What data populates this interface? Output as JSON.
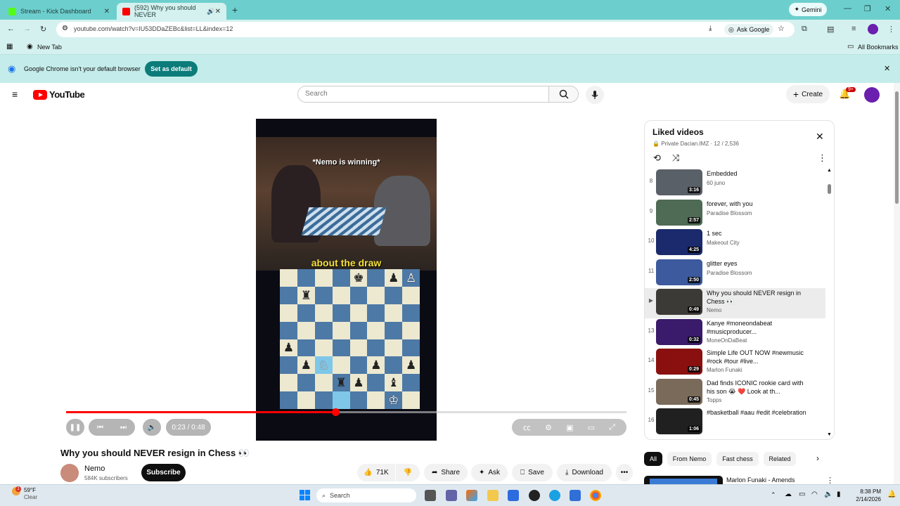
{
  "browser": {
    "tabs": [
      {
        "title": "Stream - Kick Dashboard"
      },
      {
        "title": "(592) Why you should NEVER"
      }
    ],
    "gemini_label": "Gemini",
    "url": "youtube.com/watch?v=IU53DDaZEBc&list=LL&index=12",
    "ask_google": "Ask Google",
    "bookmark_new_tab": "New Tab",
    "all_bookmarks": "All Bookmarks",
    "banner_text": "Google Chrome isn't your default browser",
    "banner_button": "Set as default"
  },
  "youtube": {
    "logo_text": "YouTube",
    "search_placeholder": "Search",
    "create_label": "Create",
    "notif_count": "9+"
  },
  "player": {
    "caption_top": "*Nemo is winning*",
    "caption_bottom": "about the draw",
    "time": "0:23 / 0:48",
    "progress": 0.48
  },
  "video": {
    "title": "Why you should NEVER resign in Chess 👀",
    "channel": "Nemo",
    "subscribers": "584K subscribers",
    "subscribe_label": "Subscribe",
    "likes": "71K",
    "share_label": "Share",
    "ask_label": "Ask",
    "save_label": "Save",
    "download_label": "Download"
  },
  "playlist": {
    "title": "Liked videos",
    "meta": "Private Dacian.IMZ · 12 / 2,536",
    "items": [
      {
        "index": "8",
        "title": "Embedded",
        "channel": "60 juno",
        "duration": "3:16",
        "color": "#5a6068"
      },
      {
        "index": "9",
        "title": "forever, with you",
        "channel": "Paradise Blossom",
        "duration": "2:57",
        "color": "#4f6a55"
      },
      {
        "index": "10",
        "title": "1 sec",
        "channel": "Makeout City",
        "duration": "4:25",
        "color": "#1a2a6c"
      },
      {
        "index": "11",
        "title": "glitter eyes",
        "channel": "Paradise Blossom",
        "duration": "2:50",
        "color": "#3d5a9e"
      },
      {
        "index": "▶",
        "title": "Why you should NEVER resign in Chess 👀",
        "channel": "Nemo",
        "duration": "0:49",
        "color": "#3c3a36"
      },
      {
        "index": "13",
        "title": "Kanye #moneondabeat #musicproducer...",
        "channel": "MoneOnDaBeat",
        "duration": "0:32",
        "color": "#3a1a6a"
      },
      {
        "index": "14",
        "title": "Simple Life OUT NOW #newmusic #rock #tour #live...",
        "channel": "Marlon Funaki",
        "duration": "0:29",
        "color": "#8a1010"
      },
      {
        "index": "15",
        "title": "Dad finds ICONIC rookie card with his son 😭 ❤️ Look at th...",
        "channel": "Topps",
        "duration": "0:45",
        "color": "#7a6a5a"
      },
      {
        "index": "16",
        "title": "#basketball #aau #edit #celebration",
        "channel": "",
        "duration": "1:06",
        "color": "#202020"
      }
    ]
  },
  "chips": [
    "All",
    "From Nemo",
    "Fast chess",
    "Related"
  ],
  "next_video": {
    "title": "Marlon Funaki - Amends"
  },
  "taskbar": {
    "weather_temp": "59°F",
    "weather_desc": "Clear",
    "search_label": "Search",
    "time": "8:38 PM",
    "date": "2/14/2026"
  }
}
